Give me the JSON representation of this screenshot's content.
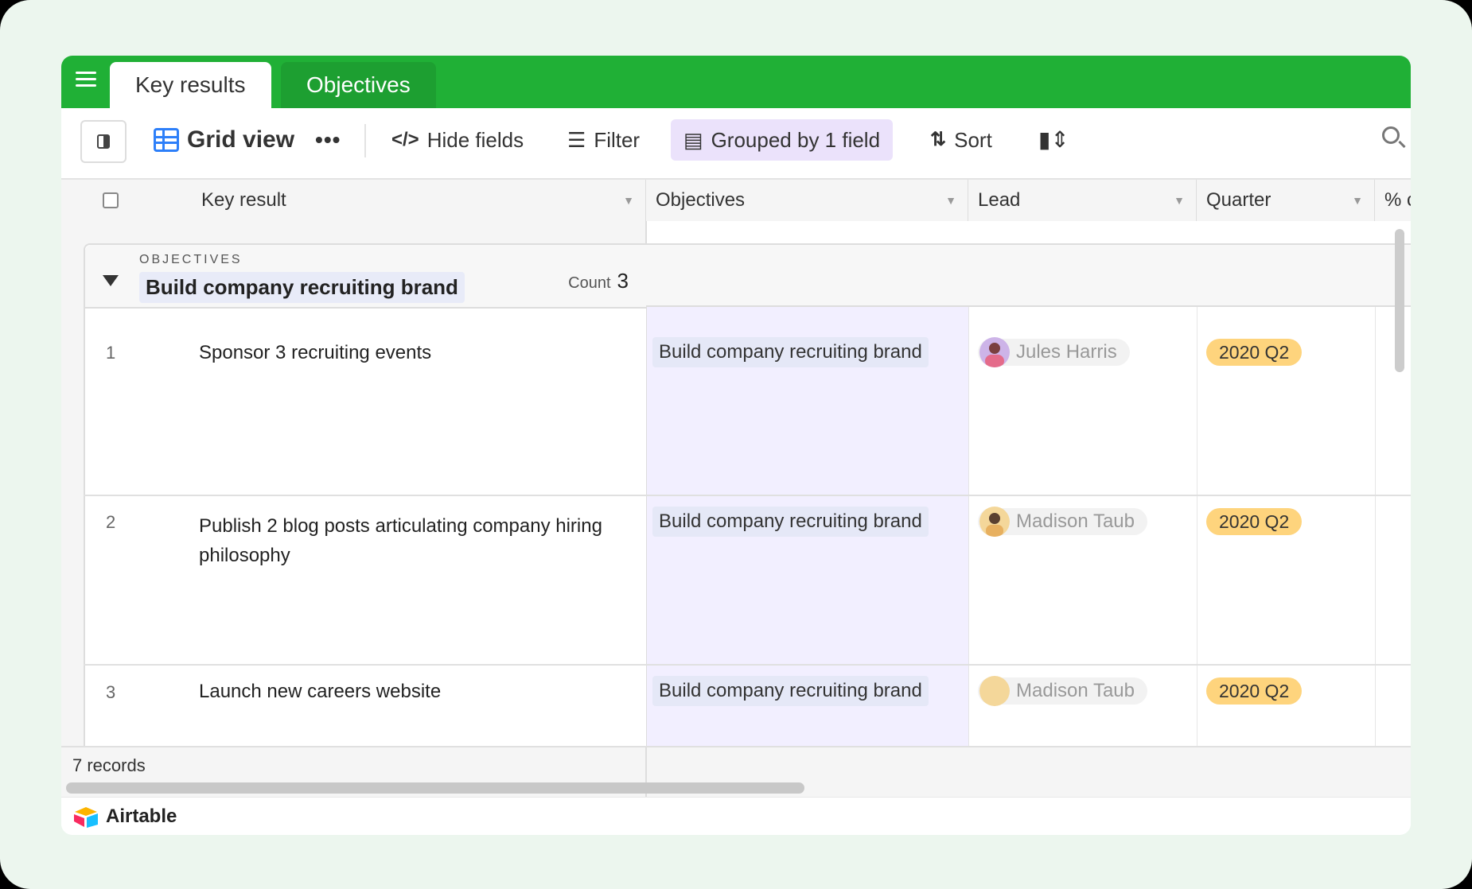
{
  "tabs": [
    {
      "label": "Key results",
      "active": true
    },
    {
      "label": "Objectives",
      "active": false
    }
  ],
  "toolbar": {
    "view_name": "Grid view",
    "more": "•••",
    "hide_fields": "Hide fields",
    "filter": "Filter",
    "grouped": "Grouped by 1 field",
    "sort": "Sort"
  },
  "columns": {
    "key_result": "Key result",
    "objectives": "Objectives",
    "lead": "Lead",
    "quarter": "Quarter",
    "percent": "% c"
  },
  "group": {
    "label": "OBJECTIVES",
    "value": "Build company recruiting brand",
    "count_label": "Count",
    "count": "3"
  },
  "rows": [
    {
      "num": "1",
      "key_result": "Sponsor 3 recruiting events",
      "objective": "Build company recruiting brand",
      "lead": "Jules Harris",
      "quarter": "2020 Q2"
    },
    {
      "num": "2",
      "key_result": "Publish 2 blog posts articulating company hiring philosophy",
      "objective": "Build company recruiting brand",
      "lead": "Madison Taub",
      "quarter": "2020 Q2"
    },
    {
      "num": "3",
      "key_result": "Launch new careers website",
      "objective": "Build company recruiting brand",
      "lead": "Madison Taub",
      "quarter": "2020 Q2"
    }
  ],
  "footer": {
    "records": "7 records"
  },
  "brand": {
    "name": "Airtable"
  },
  "colors": {
    "topbar": "#20b036",
    "objective_column": "#f2efff",
    "quarter_pill": "#fed47d",
    "grouped_pill": "#ebe2fb",
    "grid_icon": "#2d7ff9"
  }
}
